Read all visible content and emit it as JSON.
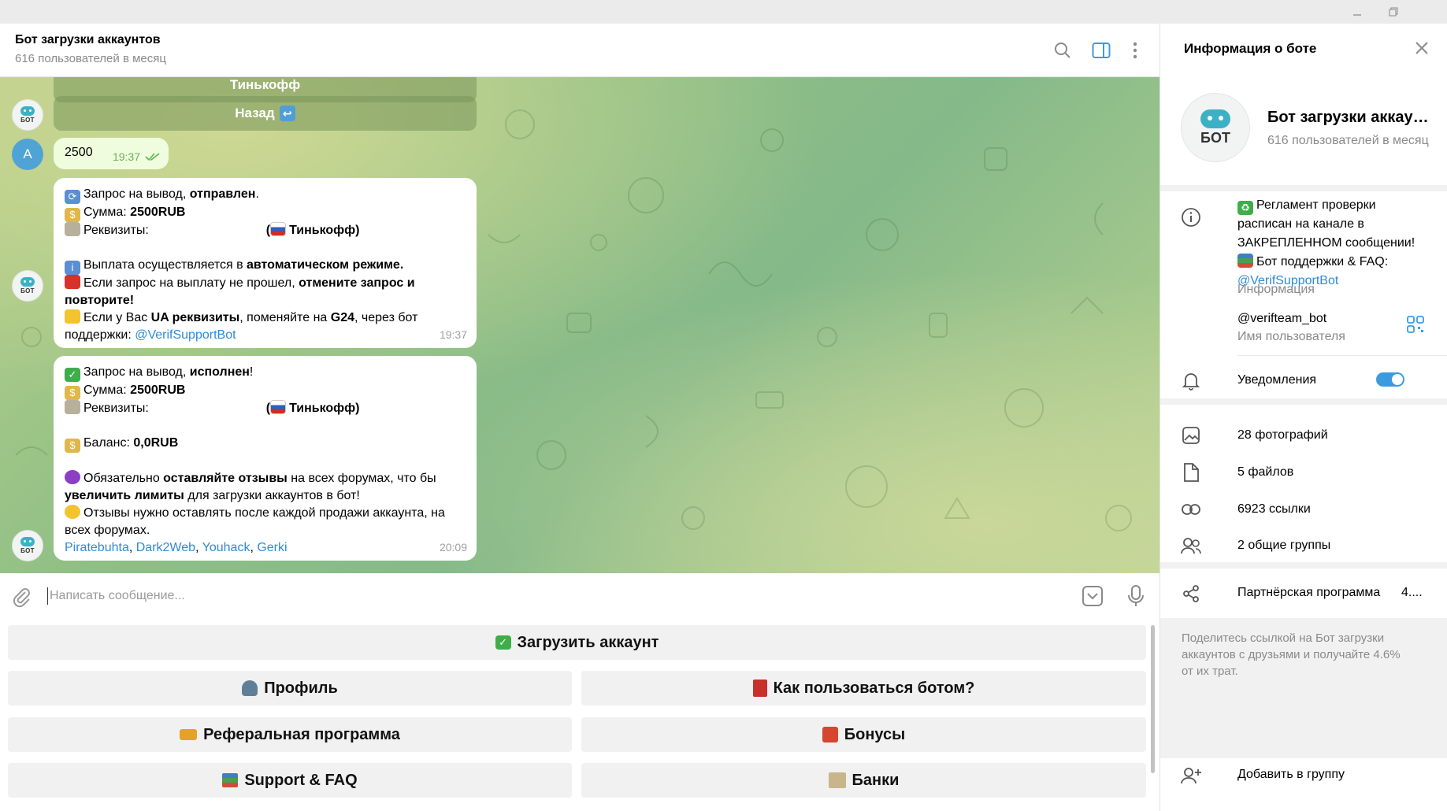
{
  "window": {
    "controls": [
      "minimize",
      "restore"
    ]
  },
  "chat": {
    "title": "Бот загрузки аккаунтов",
    "subtitle": "616 пользователей в месяц",
    "old_keyboard": {
      "top_label": "Тинькофф",
      "back_label": "Назад"
    },
    "user_avatar_letter": "A",
    "user_message": {
      "text": "2500",
      "time": "19:37"
    },
    "msg1": {
      "line1_a": "Запрос на вывод, ",
      "line1_b": "отправлен",
      "line1_c": ".",
      "line2_a": "Сумма: ",
      "line2_b": "2500RUB",
      "line3_a": "Реквизиты: ",
      "line3_b": "(",
      "line3_c": "Тинькофф)",
      "line4_a": "Выплата осуществляется в ",
      "line4_b": "автоматическом режиме.",
      "line5_a": "Если запрос на выплату не прошел, ",
      "line5_b": "отмените запрос и",
      "line6_b": "повторите!",
      "line7_a": "Если у Вас ",
      "line7_b": "UA реквизиты",
      "line7_c": ", поменяйте на ",
      "line7_d": "G24",
      "line7_e": ", через бот",
      "line8_a": "поддержки: ",
      "line8_link": "@VerifSupportBot",
      "time": "19:37"
    },
    "msg2": {
      "line1_a": "Запрос на вывод, ",
      "line1_b": "исполнен",
      "line1_c": "!",
      "line2_a": "Сумма: ",
      "line2_b": "2500RUB",
      "line3_a": "Реквизиты: ",
      "line3_b": "(",
      "line3_c": "Тинькофф)",
      "line4_a": "Баланс: ",
      "line4_b": "0,0RUB",
      "line5_a": "Обязательно ",
      "line5_b": "оставляйте отзывы",
      "line5_c": " на всех форумах, что бы",
      "line6_b": "увеличить лимиты",
      "line6_c": " для загрузки аккаунтов в бот!",
      "line7_a": "Отзывы нужно оставлять после каждой продажи аккаунта, на",
      "line8_a": "всех форумах.",
      "links": [
        "Piratebuhta",
        "Dark2Web",
        "Youhack",
        "Gerki"
      ],
      "sep": ", ",
      "time": "20:09"
    },
    "input_placeholder": "Написать сообщение..."
  },
  "keyboard": {
    "upload": "Загрузить аккаунт",
    "profile": "Профиль",
    "howto": "Как пользоваться ботом?",
    "referral": "Реферальная программа",
    "bonuses": "Бонусы",
    "support": "Support & FAQ",
    "banks": "Банки"
  },
  "panel": {
    "title": "Информация о боте",
    "bot_name": "Бот загрузки аккаунтов",
    "bot_sub": "616 пользователей в месяц",
    "avatar_label": "БОТ",
    "info_lines": [
      "Регламент проверки",
      "расписан на канале в",
      "ЗАКРЕПЛЕННОМ сообщении!",
      "Бот поддержки & FAQ:"
    ],
    "info_link": "@VerifSupportBot",
    "info_caption": "Информация",
    "username": "@verifteam_bot",
    "username_caption": "Имя пользователя",
    "notifications": "Уведомления",
    "notifications_on": true,
    "media": [
      {
        "icon": "photo-icon",
        "label": "28 фотографий"
      },
      {
        "icon": "file-icon",
        "label": "5 файлов"
      },
      {
        "icon": "link-icon",
        "label": "6923 ссылки"
      },
      {
        "icon": "groups-icon",
        "label": "2 общие группы"
      }
    ],
    "partner": "Партнёрская программа",
    "partner_value": "4....",
    "partner_desc": [
      "Поделитесь ссылкой на Бот загрузки",
      "аккаунтов с друзьями и получайте 4.6%",
      "от их трат."
    ],
    "add_to_group": "Добавить в группу"
  },
  "colors": {
    "accent": "#3c9be0",
    "link": "#2f8ad6",
    "out_bubble": "#effdde"
  }
}
